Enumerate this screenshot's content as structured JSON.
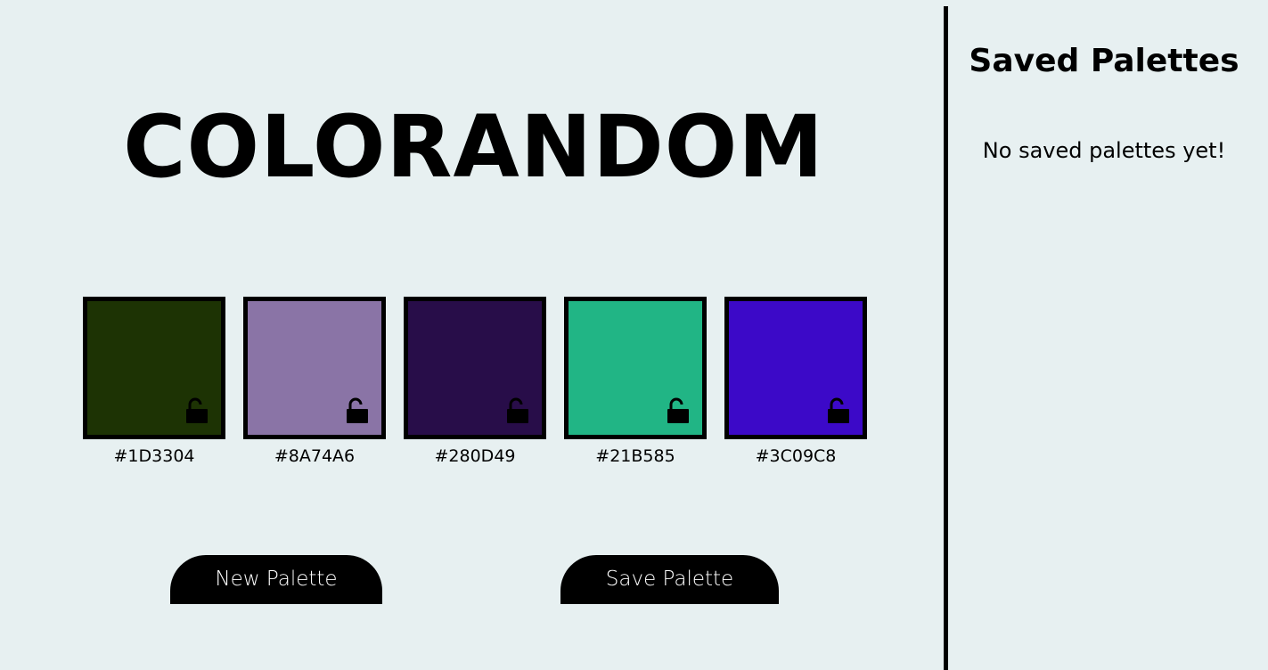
{
  "app": {
    "title": "COLORANDOM"
  },
  "palette": {
    "swatches": [
      {
        "hex": "#1D3304",
        "color": "#1D3304",
        "locked": false,
        "lock_icon": "unlocked-padlock-icon"
      },
      {
        "hex": "#8A74A6",
        "color": "#8A74A6",
        "locked": false,
        "lock_icon": "unlocked-padlock-icon"
      },
      {
        "hex": "#280D49",
        "color": "#280D49",
        "locked": false,
        "lock_icon": "unlocked-padlock-icon"
      },
      {
        "hex": "#21B585",
        "color": "#21B585",
        "locked": false,
        "lock_icon": "unlocked-padlock-icon"
      },
      {
        "hex": "#3C09C8",
        "color": "#3C09C8",
        "locked": false,
        "lock_icon": "unlocked-padlock-icon"
      }
    ]
  },
  "buttons": {
    "new_palette": "New Palette",
    "save_palette": "Save Palette"
  },
  "sidebar": {
    "title": "Saved Palettes",
    "empty_message": "No saved palettes yet!"
  },
  "colors": {
    "background": "#E7F0F1",
    "button_bg": "#000000",
    "button_text": "#FFFFFF",
    "border": "#000000"
  }
}
